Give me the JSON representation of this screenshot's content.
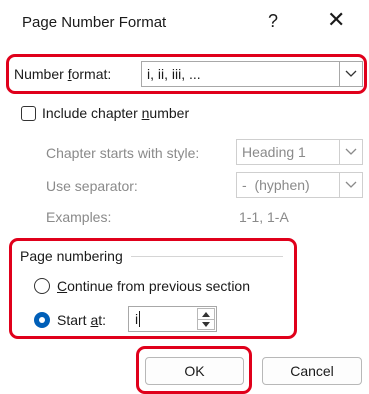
{
  "dialog": {
    "title": "Page Number Format",
    "help_glyph": "?",
    "close_glyph": "✕"
  },
  "number_format": {
    "label_pre": "Number ",
    "label_accel": "f",
    "label_post": "ormat:",
    "value": "i, ii, iii, ..."
  },
  "include_chapter": {
    "label_pre": "Include chapter ",
    "label_accel": "n",
    "label_post": "umber",
    "checked": false
  },
  "chapter_style": {
    "label": "Chapter starts with style:",
    "value": "Heading 1"
  },
  "separator": {
    "label": "Use separator:",
    "value": "-  (hyphen)"
  },
  "examples": {
    "label": "Examples:",
    "value": "1-1, 1-A"
  },
  "page_numbering": {
    "heading": "Page numbering",
    "continue_accel": "C",
    "continue_rest": "ontinue from previous section",
    "start_pre": "Start ",
    "start_accel": "a",
    "start_post": "t:",
    "start_value": "i",
    "selected": "start_at"
  },
  "buttons": {
    "ok": "OK",
    "cancel": "Cancel"
  },
  "colors": {
    "highlight": "#e0001b",
    "accent": "#005fb8"
  }
}
